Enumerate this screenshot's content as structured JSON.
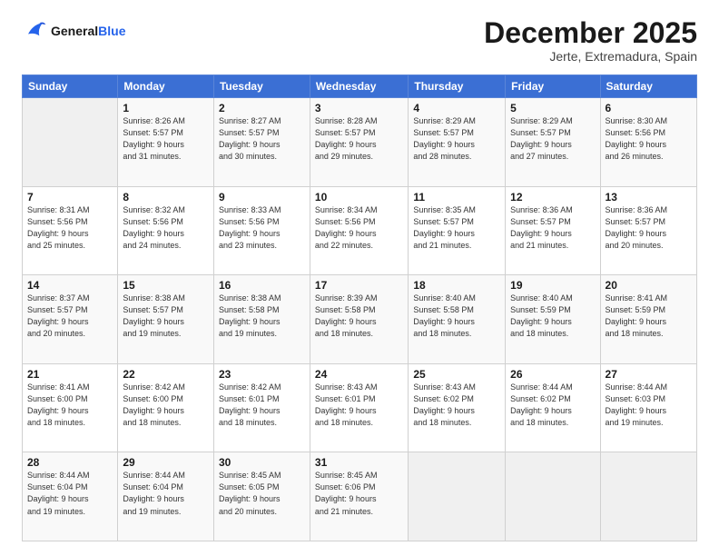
{
  "logo": {
    "line1": "General",
    "line2": "Blue"
  },
  "title": "December 2025",
  "location": "Jerte, Extremadura, Spain",
  "weekdays": [
    "Sunday",
    "Monday",
    "Tuesday",
    "Wednesday",
    "Thursday",
    "Friday",
    "Saturday"
  ],
  "weeks": [
    [
      {
        "day": "",
        "info": ""
      },
      {
        "day": "1",
        "info": "Sunrise: 8:26 AM\nSunset: 5:57 PM\nDaylight: 9 hours\nand 31 minutes."
      },
      {
        "day": "2",
        "info": "Sunrise: 8:27 AM\nSunset: 5:57 PM\nDaylight: 9 hours\nand 30 minutes."
      },
      {
        "day": "3",
        "info": "Sunrise: 8:28 AM\nSunset: 5:57 PM\nDaylight: 9 hours\nand 29 minutes."
      },
      {
        "day": "4",
        "info": "Sunrise: 8:29 AM\nSunset: 5:57 PM\nDaylight: 9 hours\nand 28 minutes."
      },
      {
        "day": "5",
        "info": "Sunrise: 8:29 AM\nSunset: 5:57 PM\nDaylight: 9 hours\nand 27 minutes."
      },
      {
        "day": "6",
        "info": "Sunrise: 8:30 AM\nSunset: 5:56 PM\nDaylight: 9 hours\nand 26 minutes."
      }
    ],
    [
      {
        "day": "7",
        "info": "Sunrise: 8:31 AM\nSunset: 5:56 PM\nDaylight: 9 hours\nand 25 minutes."
      },
      {
        "day": "8",
        "info": "Sunrise: 8:32 AM\nSunset: 5:56 PM\nDaylight: 9 hours\nand 24 minutes."
      },
      {
        "day": "9",
        "info": "Sunrise: 8:33 AM\nSunset: 5:56 PM\nDaylight: 9 hours\nand 23 minutes."
      },
      {
        "day": "10",
        "info": "Sunrise: 8:34 AM\nSunset: 5:56 PM\nDaylight: 9 hours\nand 22 minutes."
      },
      {
        "day": "11",
        "info": "Sunrise: 8:35 AM\nSunset: 5:57 PM\nDaylight: 9 hours\nand 21 minutes."
      },
      {
        "day": "12",
        "info": "Sunrise: 8:36 AM\nSunset: 5:57 PM\nDaylight: 9 hours\nand 21 minutes."
      },
      {
        "day": "13",
        "info": "Sunrise: 8:36 AM\nSunset: 5:57 PM\nDaylight: 9 hours\nand 20 minutes."
      }
    ],
    [
      {
        "day": "14",
        "info": "Sunrise: 8:37 AM\nSunset: 5:57 PM\nDaylight: 9 hours\nand 20 minutes."
      },
      {
        "day": "15",
        "info": "Sunrise: 8:38 AM\nSunset: 5:57 PM\nDaylight: 9 hours\nand 19 minutes."
      },
      {
        "day": "16",
        "info": "Sunrise: 8:38 AM\nSunset: 5:58 PM\nDaylight: 9 hours\nand 19 minutes."
      },
      {
        "day": "17",
        "info": "Sunrise: 8:39 AM\nSunset: 5:58 PM\nDaylight: 9 hours\nand 18 minutes."
      },
      {
        "day": "18",
        "info": "Sunrise: 8:40 AM\nSunset: 5:58 PM\nDaylight: 9 hours\nand 18 minutes."
      },
      {
        "day": "19",
        "info": "Sunrise: 8:40 AM\nSunset: 5:59 PM\nDaylight: 9 hours\nand 18 minutes."
      },
      {
        "day": "20",
        "info": "Sunrise: 8:41 AM\nSunset: 5:59 PM\nDaylight: 9 hours\nand 18 minutes."
      }
    ],
    [
      {
        "day": "21",
        "info": "Sunrise: 8:41 AM\nSunset: 6:00 PM\nDaylight: 9 hours\nand 18 minutes."
      },
      {
        "day": "22",
        "info": "Sunrise: 8:42 AM\nSunset: 6:00 PM\nDaylight: 9 hours\nand 18 minutes."
      },
      {
        "day": "23",
        "info": "Sunrise: 8:42 AM\nSunset: 6:01 PM\nDaylight: 9 hours\nand 18 minutes."
      },
      {
        "day": "24",
        "info": "Sunrise: 8:43 AM\nSunset: 6:01 PM\nDaylight: 9 hours\nand 18 minutes."
      },
      {
        "day": "25",
        "info": "Sunrise: 8:43 AM\nSunset: 6:02 PM\nDaylight: 9 hours\nand 18 minutes."
      },
      {
        "day": "26",
        "info": "Sunrise: 8:44 AM\nSunset: 6:02 PM\nDaylight: 9 hours\nand 18 minutes."
      },
      {
        "day": "27",
        "info": "Sunrise: 8:44 AM\nSunset: 6:03 PM\nDaylight: 9 hours\nand 19 minutes."
      }
    ],
    [
      {
        "day": "28",
        "info": "Sunrise: 8:44 AM\nSunset: 6:04 PM\nDaylight: 9 hours\nand 19 minutes."
      },
      {
        "day": "29",
        "info": "Sunrise: 8:44 AM\nSunset: 6:04 PM\nDaylight: 9 hours\nand 19 minutes."
      },
      {
        "day": "30",
        "info": "Sunrise: 8:45 AM\nSunset: 6:05 PM\nDaylight: 9 hours\nand 20 minutes."
      },
      {
        "day": "31",
        "info": "Sunrise: 8:45 AM\nSunset: 6:06 PM\nDaylight: 9 hours\nand 21 minutes."
      },
      {
        "day": "",
        "info": ""
      },
      {
        "day": "",
        "info": ""
      },
      {
        "day": "",
        "info": ""
      }
    ]
  ]
}
